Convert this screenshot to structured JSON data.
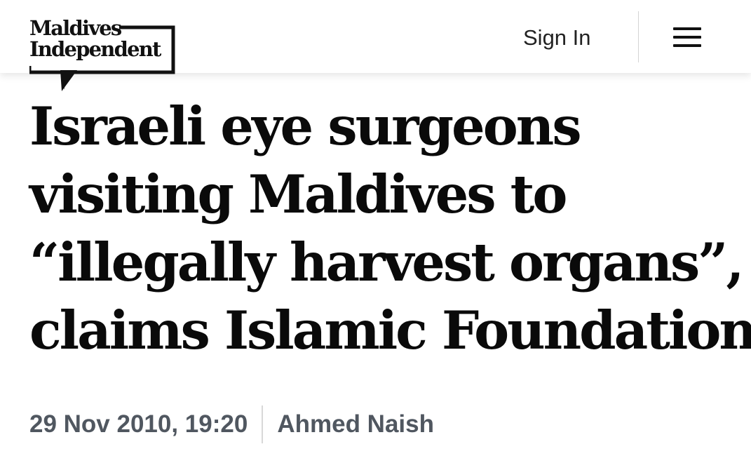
{
  "header": {
    "logo_line1": "Maldives",
    "logo_line2": "Independent",
    "sign_in_label": "Sign In",
    "menu_icon": "hamburger-menu-icon"
  },
  "article": {
    "headline_lines": [
      "Israeli eye surgeons",
      "visiting Maldives to",
      "“illegally harvest organs”,",
      "claims Islamic Foundation"
    ],
    "date": "29 Nov 2010, 19:20",
    "author": "Ahmed Naish"
  },
  "colors": {
    "text": "#0a0a0a",
    "byline": "#505760",
    "divider": "#d8d8d8",
    "background": "#ffffff"
  }
}
